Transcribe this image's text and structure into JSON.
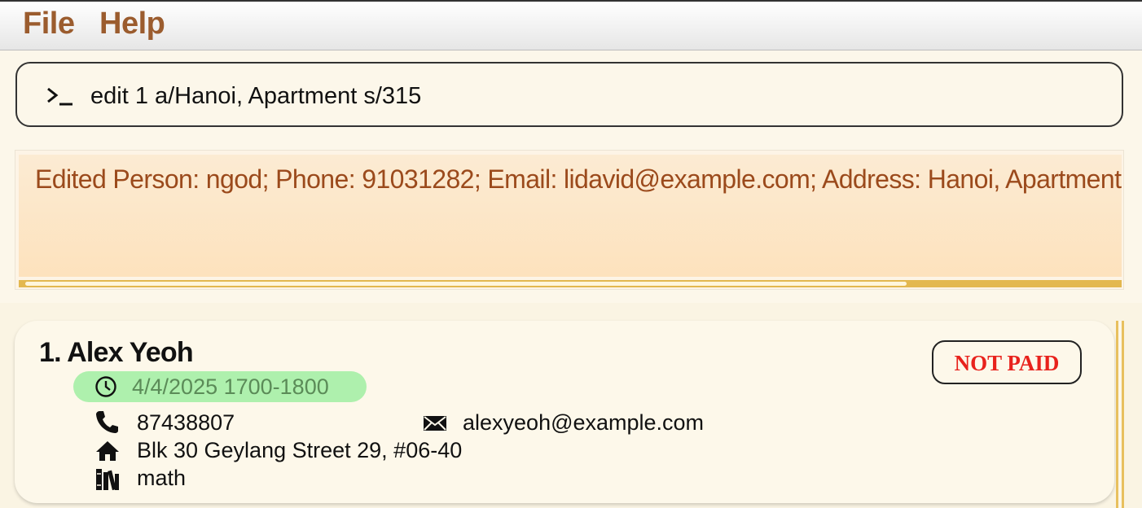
{
  "menu": {
    "file": "File",
    "help": "Help"
  },
  "command_box": {
    "value": "edit 1 a/Hanoi, Apartment s/315"
  },
  "result": {
    "text": "Edited Person: ngod; Phone: 91031282; Email: lidavid@example.com; Address: Hanoi, Apartment"
  },
  "person_card": {
    "name": "1. Alex Yeoh",
    "schedule": "4/4/2025 1700-1800",
    "phone": "87438807",
    "email": "alexyeoh@example.com",
    "address": "Blk 30 Geylang Street 29, #06-40",
    "subject": "math",
    "status": "NOT PAID"
  },
  "icons": [
    "terminal-prompt-icon",
    "clock-icon",
    "phone-icon",
    "mail-icon",
    "home-icon",
    "books-icon"
  ],
  "colors": {
    "menu_text": "#9b5c2e",
    "result_text": "#9b4a1c",
    "schedule_bg": "#aef0ad",
    "status_text": "#e8221c",
    "accent": "#e3b84f"
  }
}
